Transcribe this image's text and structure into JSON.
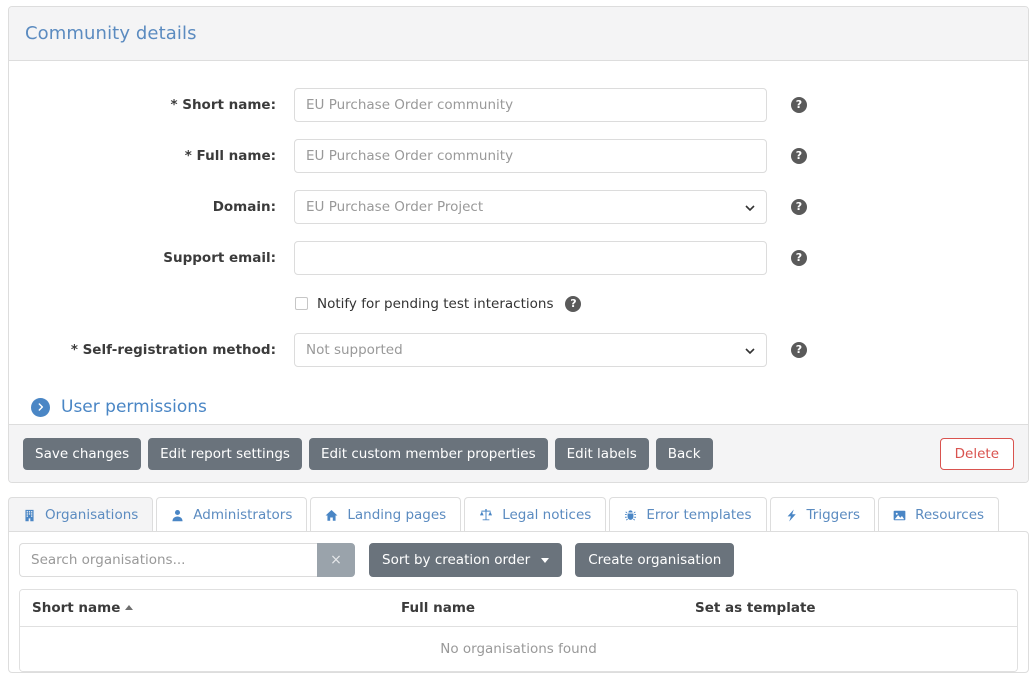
{
  "card": {
    "title": "Community details"
  },
  "form": {
    "fields": [
      {
        "label": "* Short name:",
        "value": "EU Purchase Order community",
        "type": "text",
        "help": "?"
      },
      {
        "label": "* Full name:",
        "value": "EU Purchase Order community",
        "type": "text",
        "help": "?"
      },
      {
        "label": "Domain:",
        "value": "EU Purchase Order Project",
        "type": "select",
        "help": "?"
      },
      {
        "label": "Support email:",
        "value": "",
        "type": "text",
        "help": "?"
      }
    ],
    "checkbox": {
      "label": "Notify for pending test interactions",
      "checked": false,
      "help": "?"
    },
    "self_registration": {
      "label": "* Self-registration method:",
      "value": "Not supported",
      "type": "select",
      "help": "?"
    }
  },
  "permissions": {
    "label": "User permissions",
    "icon": "chevron-right-circle-icon",
    "color": "#4a86c5"
  },
  "footer": {
    "buttons": [
      "Save changes",
      "Edit report settings",
      "Edit custom member properties",
      "Edit labels",
      "Back"
    ],
    "delete_label": "Delete",
    "delete_color": "#d9534f"
  },
  "tabs": [
    {
      "label": "Organisations",
      "icon": "building-icon",
      "active": true
    },
    {
      "label": "Administrators",
      "icon": "user-icon",
      "active": false
    },
    {
      "label": "Landing pages",
      "icon": "home-icon",
      "active": false
    },
    {
      "label": "Legal notices",
      "icon": "scales-icon",
      "active": false
    },
    {
      "label": "Error templates",
      "icon": "bug-icon",
      "active": false
    },
    {
      "label": "Triggers",
      "icon": "bolt-icon",
      "active": false
    },
    {
      "label": "Resources",
      "icon": "image-icon",
      "active": false
    }
  ],
  "toolbar": {
    "search_placeholder": "Search organisations...",
    "search_value": "",
    "clear_label": "×",
    "sort_label": "Sort by creation order",
    "create_label": "Create organisation"
  },
  "table": {
    "columns": [
      "Short name",
      "Full name",
      "Set as template"
    ],
    "sort_column": "Short name",
    "sort_direction": "asc",
    "rows": [],
    "empty_message": "No organisations found"
  }
}
